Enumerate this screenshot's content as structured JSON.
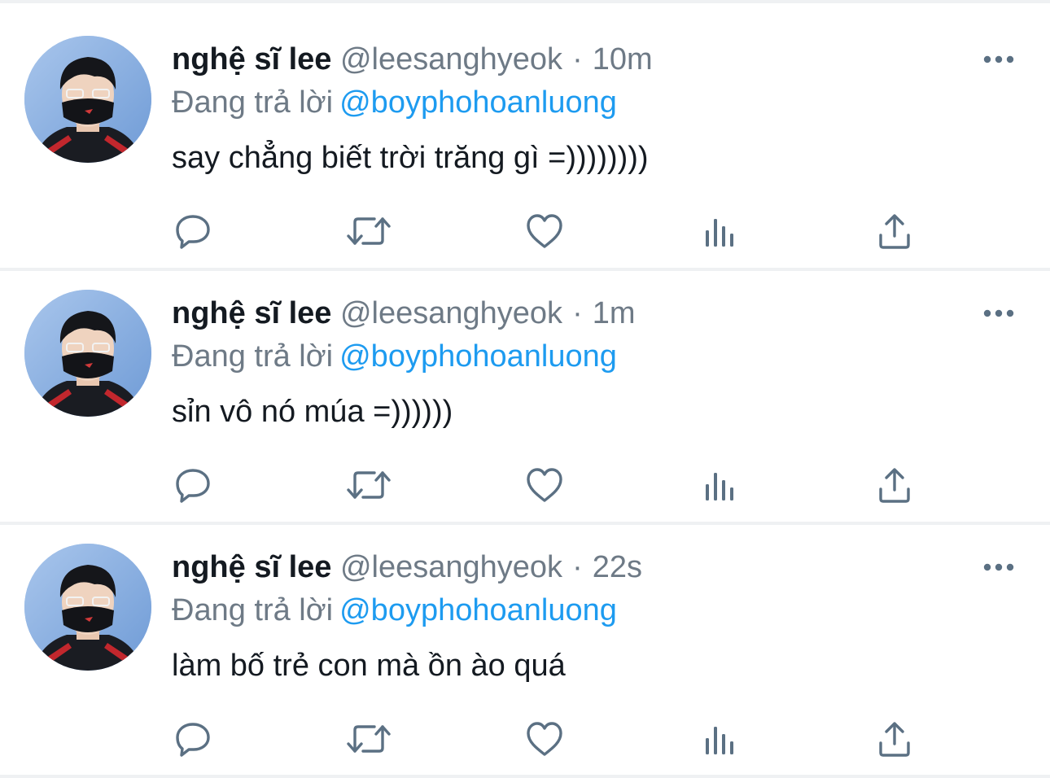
{
  "colors": {
    "name": "#141a21",
    "meta": "#6e7a86",
    "mention": "#1d9bf0",
    "divider": "#eff1f3",
    "icon": "#5b7083"
  },
  "tweets": [
    {
      "name": "nghệ sĩ lee",
      "handle": "@leesanghyeok",
      "separator": "·",
      "time": "10m",
      "reply_prefix": "Đang trả lời",
      "reply_to": "@boyphohoanluong",
      "text": "say chẳng biết trời trăng gì =))))))))",
      "actions": [
        "reply-icon",
        "retweet-icon",
        "like-icon",
        "analytics-icon",
        "share-icon"
      ]
    },
    {
      "name": "nghệ sĩ lee",
      "handle": "@leesanghyeok",
      "separator": "·",
      "time": "1m",
      "reply_prefix": "Đang trả lời",
      "reply_to": "@boyphohoanluong",
      "text": "sỉn vô nó múa =))))))",
      "actions": [
        "reply-icon",
        "retweet-icon",
        "like-icon",
        "analytics-icon",
        "share-icon"
      ]
    },
    {
      "name": "nghệ sĩ lee",
      "handle": "@leesanghyeok",
      "separator": "·",
      "time": "22s",
      "reply_prefix": "Đang trả lời",
      "reply_to": "@boyphohoanluong",
      "text": "làm bố trẻ con mà ồn ào quá",
      "actions": [
        "reply-icon",
        "retweet-icon",
        "like-icon",
        "analytics-icon",
        "share-icon"
      ]
    }
  ]
}
